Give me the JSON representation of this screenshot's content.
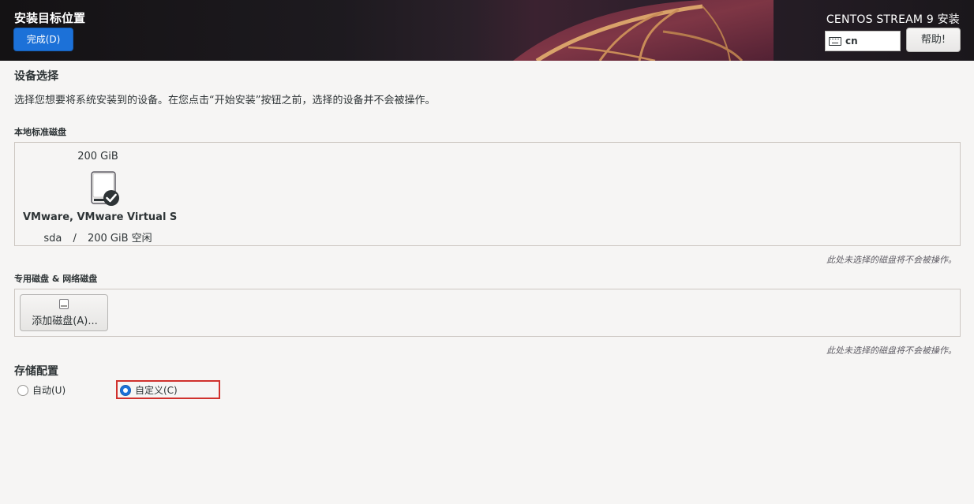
{
  "header": {
    "title": "安装目标位置",
    "done_label": "完成(D)",
    "product_name": "CENTOS STREAM 9 安装",
    "keyboard_layout": "cn",
    "help_label": "帮助!"
  },
  "device_selection": {
    "heading": "设备选择",
    "description": "选择您想要将系统安装到的设备。在您点击“开始安装”按钮之前，选择的设备并不会被操作。"
  },
  "local_disks": {
    "heading": "本地标准磁盘",
    "disks": [
      {
        "size": "200 GiB",
        "name": "VMware, VMware Virtual S",
        "device": "sda",
        "separator": "/",
        "free": "200 GiB 空闲",
        "selected": true
      }
    ],
    "note": "此处未选择的磁盘将不会被操作。"
  },
  "specialized_disks": {
    "heading": "专用磁盘 & 网络磁盘",
    "add_disk_label": "添加磁盘(A)...",
    "note": "此处未选择的磁盘将不会被操作。"
  },
  "storage_config": {
    "heading": "存储配置",
    "options": [
      {
        "label": "自动(U)",
        "checked": false
      },
      {
        "label": "自定义(C)",
        "checked": true
      }
    ]
  },
  "colors": {
    "accent": "#1c71d8",
    "highlight": "#d0312d"
  },
  "icons": {
    "keyboard": "keyboard-icon",
    "disk": "harddisk-icon",
    "disk_selected": "checkmark-icon",
    "add_disk": "disk-small-icon"
  }
}
